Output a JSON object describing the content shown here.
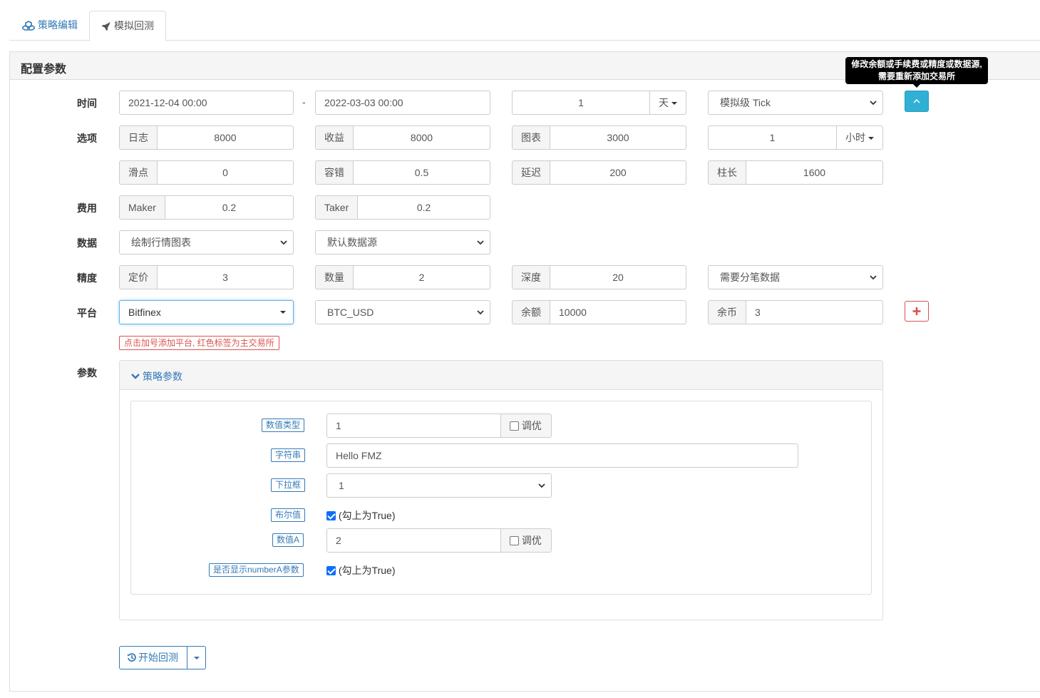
{
  "tabs": [
    {
      "label": "策略编辑",
      "icon": "cubes-icon"
    },
    {
      "label": "模拟回测",
      "icon": "rocket-icon"
    }
  ],
  "panel_title": "配置参数",
  "tooltip": {
    "line1": "修改余额或手续费或精度或数据源,",
    "line2": "需要重新添加交易所"
  },
  "rows": {
    "time": {
      "label": "时间",
      "start": "2021-12-04 00:00",
      "dash": "-",
      "end": "2022-03-03 00:00",
      "period_value": "1",
      "period_unit": "天",
      "tick_mode": "模拟级 Tick"
    },
    "options": {
      "label": "选项",
      "log_label": "日志",
      "log_value": "8000",
      "profit_label": "收益",
      "profit_value": "8000",
      "chart_label": "图表",
      "chart_value": "3000",
      "kline_value": "1",
      "kline_unit": "小时"
    },
    "options2": {
      "slip_label": "滑点",
      "slip_value": "0",
      "tol_label": "容错",
      "tol_value": "0.5",
      "delay_label": "延迟",
      "delay_value": "200",
      "bar_label": "柱长",
      "bar_value": "1600"
    },
    "fee": {
      "label": "费用",
      "maker_label": "Maker",
      "maker_value": "0.2",
      "taker_label": "Taker",
      "taker_value": "0.2"
    },
    "data": {
      "label": "数据",
      "chart_option": "绘制行情图表",
      "source_option": "默认数据源"
    },
    "precision": {
      "label": "精度",
      "price_label": "定价",
      "price_value": "3",
      "qty_label": "数量",
      "qty_value": "2",
      "depth_label": "深度",
      "depth_value": "20",
      "trade_option": "需要分笔数据"
    },
    "platform": {
      "label": "平台",
      "exchange": "Bitfinex",
      "pair": "BTC_USD",
      "balance_label": "余额",
      "balance_value": "10000",
      "coin_label": "余币",
      "coin_value": "3"
    }
  },
  "hint": "点击加号添加平台, 红色标签为主交易所",
  "params": {
    "label": "参数",
    "panel_title": "策略参数",
    "items": [
      {
        "label": "数值类型",
        "value": "1",
        "tune": "调优"
      },
      {
        "label": "字符串",
        "value": "Hello FMZ"
      },
      {
        "label": "下拉框",
        "value": "1"
      },
      {
        "label": "布尔值",
        "check_text": "(勾上为True)"
      },
      {
        "label": "数值A",
        "value": "2",
        "tune": "调优"
      },
      {
        "label": "是否显示numberA参数",
        "check_text": "(勾上为True)"
      }
    ]
  },
  "start_button": "开始回测",
  "colors": {
    "accent": "#337ab7",
    "danger": "#d9534f",
    "info": "#31b0d5"
  }
}
